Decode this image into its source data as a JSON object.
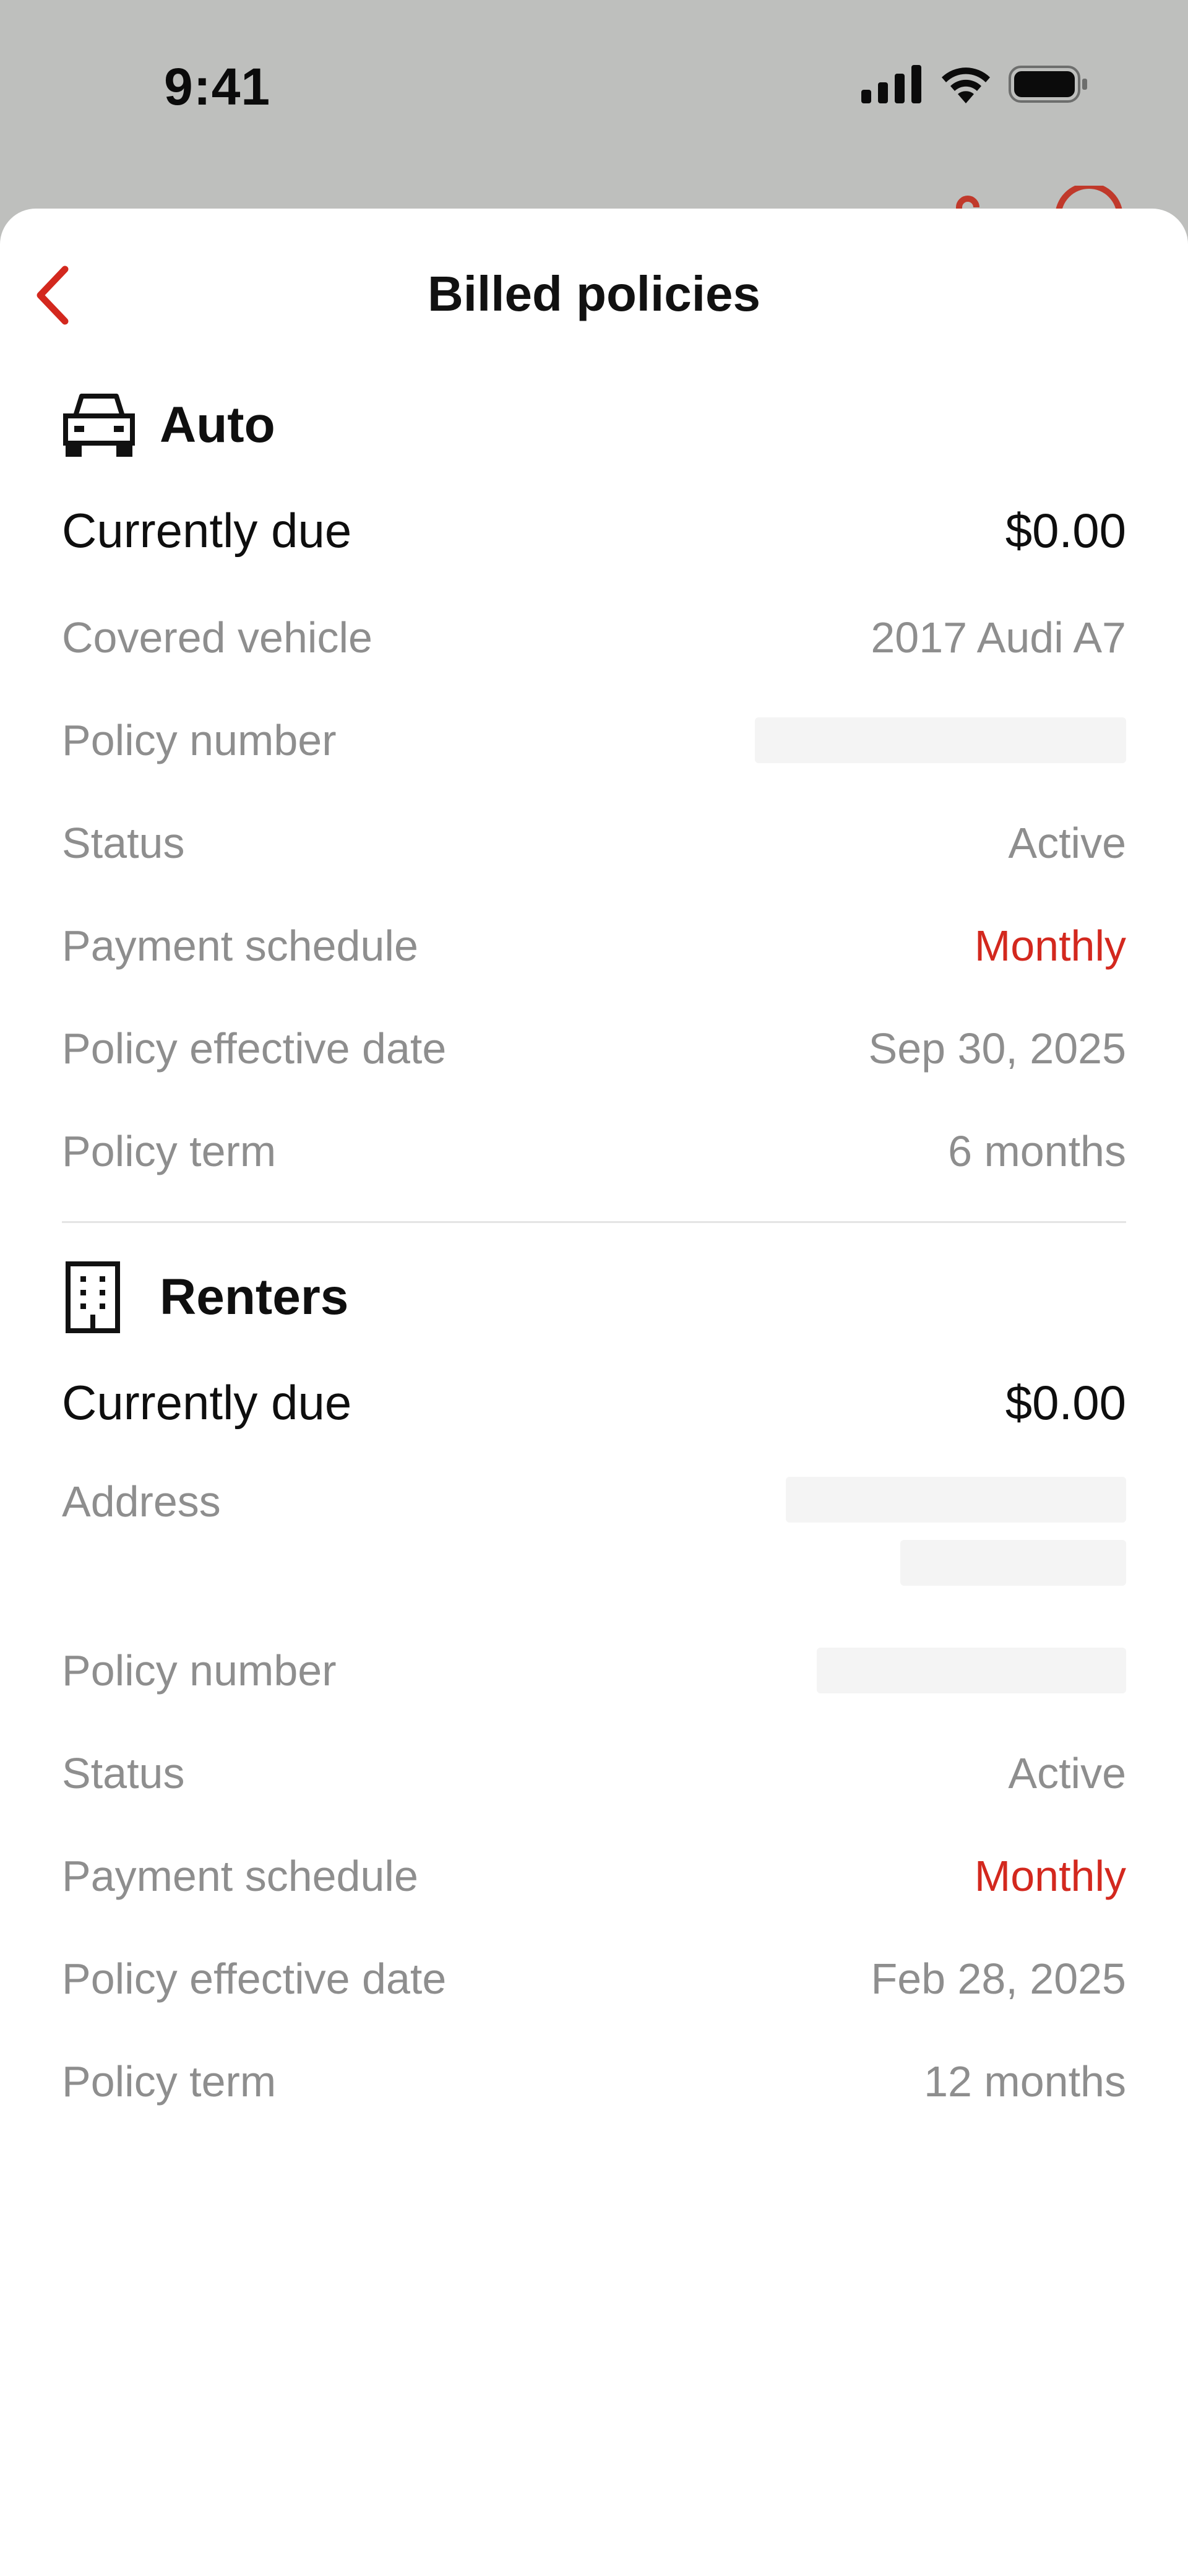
{
  "status_bar": {
    "time": "9:41"
  },
  "nav": {
    "title": "Billed policies",
    "back_icon": "chevron-left-icon"
  },
  "colors": {
    "accent": "#d3281e",
    "label": "#8e8e8e",
    "text": "#0e0e0e"
  },
  "auto": {
    "title": "Auto",
    "icon": "car-icon",
    "due_label": "Currently due",
    "due_value": "$0.00",
    "rows": {
      "vehicle_label": "Covered vehicle",
      "vehicle_value": "2017 Audi A7",
      "policy_number_label": "Policy number",
      "status_label": "Status",
      "status_value": "Active",
      "schedule_label": "Payment schedule",
      "schedule_value": "Monthly",
      "effective_label": "Policy effective date",
      "effective_value": "Sep 30, 2025",
      "term_label": "Policy term",
      "term_value": "6 months"
    }
  },
  "renters": {
    "title": "Renters",
    "icon": "building-icon",
    "due_label": "Currently due",
    "due_value": "$0.00",
    "rows": {
      "address_label": "Address",
      "policy_number_label": "Policy number",
      "status_label": "Status",
      "status_value": "Active",
      "schedule_label": "Payment schedule",
      "schedule_value": "Monthly",
      "effective_label": "Policy effective date",
      "effective_value": "Feb 28, 2025",
      "term_label": "Policy term",
      "term_value": "12 months"
    }
  }
}
